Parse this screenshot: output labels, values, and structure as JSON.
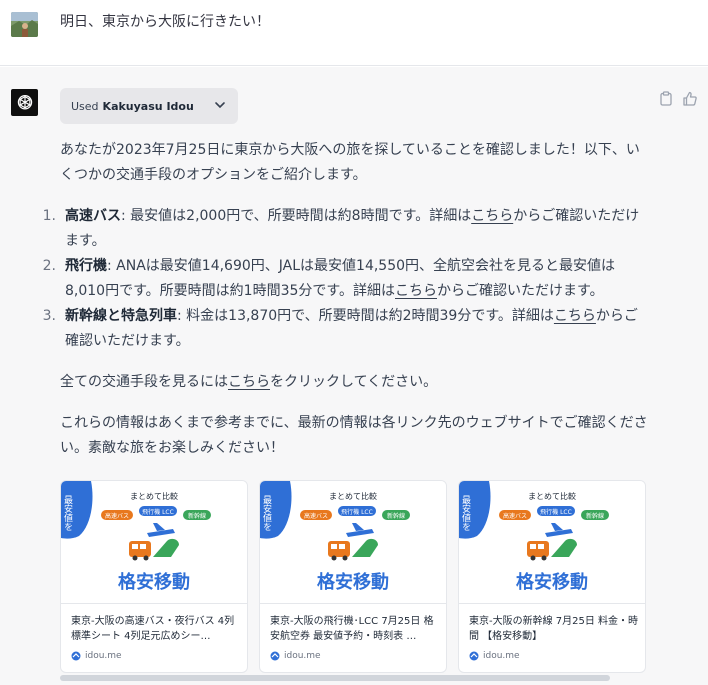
{
  "user": {
    "message": "明日、東京から大阪に行きたい！"
  },
  "assistant": {
    "plugin_used_prefix": "Used",
    "plugin_name": "Kakuyasu Idou",
    "intro": "あなたが2023年7月25日に東京から大阪への旅を探していることを確認しました！以下、いくつかの交通手段のオプションをご紹介します。",
    "options": [
      {
        "num": "1.",
        "label": "高速バス",
        "text_before": ": 最安値は2,000円で、所要時間は約8時間です。詳細は",
        "link": "こちら",
        "text_after": "からご確認いただけます。"
      },
      {
        "num": "2.",
        "label": "飛行機",
        "text_before": ": ANAは最安値14,690円、JALは最安値14,550円、全航空会社を見ると最安値は8,010円です。所要時間は約1時間35分です。詳細は",
        "link": "こちら",
        "text_after": "からご確認いただけます。"
      },
      {
        "num": "3.",
        "label": "新幹線と特急列車",
        "text_before": ": 料金は13,870円で、所要時間は約2時間39分です。詳細は",
        "link": "こちら",
        "text_after": "からご確認いただけます。"
      }
    ],
    "all_options_before": "全ての交通手段を見るには",
    "all_options_link": "こちら",
    "all_options_after": "をクリックしてください。",
    "closing": "これらの情報はあくまで参考までに、最新の情報は各リンク先のウェブサイトでご確認ください。素敵な旅をお楽しみください！"
  },
  "cards": [
    {
      "title": "東京-大阪の高速バス・夜行バス 4列標準シート 4列足元広めシー…",
      "source": "idou.me",
      "img_badge": "最安値を",
      "img_heading": "まとめて比較",
      "img_tags": [
        "高速バス",
        "飛行機 LCC",
        "新幹線"
      ],
      "img_title": "格安移動"
    },
    {
      "title": "東京-大阪の飛行機･LCC 7月25日 格安航空券 最安値予約・時刻表 …",
      "source": "idou.me",
      "img_badge": "最安値を",
      "img_heading": "まとめて比較",
      "img_tags": [
        "高速バス",
        "飛行機 LCC",
        "新幹線"
      ],
      "img_title": "格安移動"
    },
    {
      "title": "東京-大阪の新幹線 7月25日 料金・時間 【格安移動】",
      "source": "idou.me",
      "img_badge": "最安値を",
      "img_heading": "まとめて比較",
      "img_tags": [
        "高速バス",
        "飛行機 LCC",
        "新幹線"
      ],
      "img_title": "格安移動"
    }
  ],
  "colors": {
    "brand_blue": "#2f6fd6",
    "tag_orange": "#e8781e",
    "tag_blue": "#2f6fd6",
    "tag_green": "#3aa65a",
    "bot_row_bg": "#f7f7f8"
  }
}
